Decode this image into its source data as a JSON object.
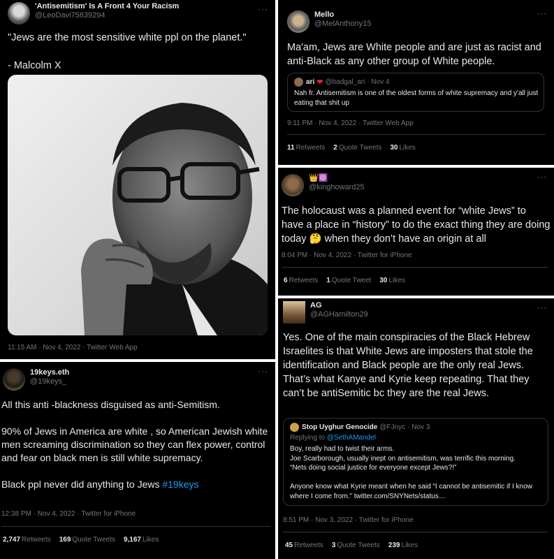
{
  "tweet1": {
    "display_name": "'Antisemitism' Is A Front 4 Your Racism",
    "handle": "@LeoDavi75839294",
    "text": "\"Jews are the most sensitive white ppl on the planet.\"\n\n- Malcolm X",
    "meta": "11:15 AM · Nov 4, 2022 · Twitter Web App",
    "more": "···"
  },
  "tweet2": {
    "display_name": "Mello",
    "handle": "@MelAnthony15",
    "text": "Ma'am, Jews are White people and are just as racist and anti-Black as any other group of White people.",
    "quote": {
      "display_name": "ari",
      "handle": "@badgal_ari",
      "date": "· Nov 4",
      "text": "Nah fr. Antisemitism is one of the oldest forms of white supremacy and y'all just eating that shit up"
    },
    "meta": "9:11 PM · Nov 4, 2022 · Twitter Web App",
    "retweets": "11",
    "retweets_label": "Retweets",
    "quotes": "2",
    "quotes_label": "Quote Tweets",
    "likes": "30",
    "likes_label": "Likes",
    "more": "···"
  },
  "tweet3": {
    "display_name": "👑☸️",
    "handle": "@kinghoward25",
    "text_a": "The holocaust was a planned event for “white Jews” to have a place in “history” to do the exact thing they are doing today ",
    "emoji": "🤔",
    "text_b": " when they don’t have an origin at all",
    "meta": "8:04 PM · Nov 4, 2022 · Twitter for iPhone",
    "retweets": "6",
    "retweets_label": "Retweets",
    "quotes": "1",
    "quotes_label": "Quote Tweet",
    "likes": "30",
    "likes_label": "Likes",
    "more": "···"
  },
  "tweet4": {
    "display_name": "19keys.eth",
    "handle": "@19keys_",
    "text_a": "All this anti -blackness disguised as anti-Semitism.\n\n90% of Jews in America are white , so American Jewish white men screaming discrimination so they can flex power, control and fear on black men is still white supremacy.\n\nBlack ppl never did anything to Jews ",
    "hashtag": "#19keys",
    "meta": "12:38 PM · Nov 4, 2022 · Twitter for iPhone",
    "retweets": "2,747",
    "retweets_label": "Retweets",
    "quotes": "169",
    "quotes_label": "Quote Tweets",
    "likes": "9,167",
    "likes_label": "Likes",
    "more": "···"
  },
  "tweet5": {
    "display_name": "AG",
    "handle": "@AGHamilton29",
    "text": "Yes. One of the main conspiracies of the Black Hebrew Israelites is that White Jews are imposters that stole the identification and Black people are the only real Jews. That’s what Kanye and Kyrie keep repeating. That they can’t be antiSemitic bc they are the real Jews.",
    "quote": {
      "display_name": "Stop Uyghur Genocide",
      "handle": "@FJnyc",
      "date": "· Nov 3",
      "replying_prefix": "Replying to ",
      "replying_handle": "@SethAMandel",
      "text": "Boy, really had to twist their arms.\nJoe Scarborough, usually inept on antisemitism, was terrific this morning.\n“Nets doing social justice for everyone except Jews?!”\n\nAnyone know what Kyrie meant when he said “I cannot be antisemitic if I know where I come from.” twitter.com/SNYNets/status…"
    },
    "meta": "8:51 PM · Nov 3, 2022 · Twitter for iPhone",
    "retweets": "45",
    "retweets_label": "Retweets",
    "quotes": "3",
    "quotes_label": "Quote Tweets",
    "likes": "239",
    "likes_label": "Likes",
    "more": "···"
  },
  "icons": {
    "heart": "heart-icon",
    "more": "more-options-icon"
  },
  "colors": {
    "background": "#000000",
    "text": "#e7e9ea",
    "muted": "#71767b",
    "link": "#1d9bf0",
    "border": "#2f3336"
  }
}
